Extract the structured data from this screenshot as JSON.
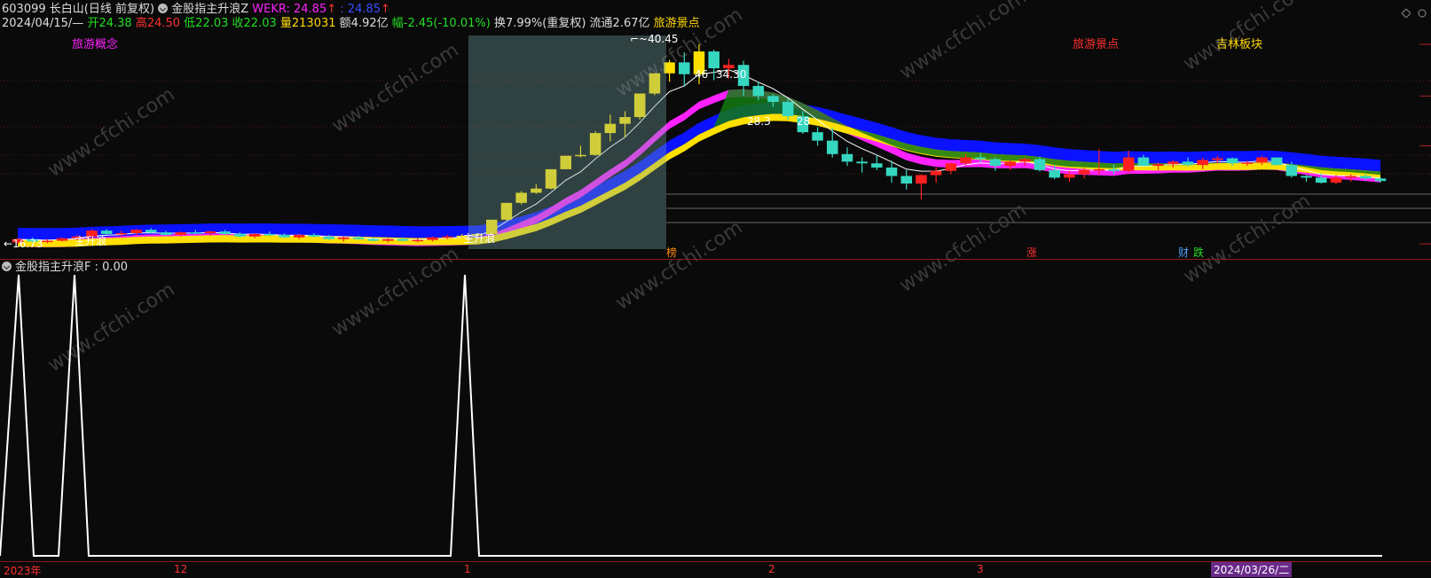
{
  "header": {
    "line1": {
      "code": "603099",
      "name": "长白山",
      "period": "(日线 前复权)",
      "indicator": "金股指主升浪Z",
      "wekr_label": "WEKR: 24.85",
      "wekr_arrow": "↑",
      "wekr2": ": 24.85",
      "wekr2_arrow": "↑"
    },
    "line2": {
      "date": "2024/04/15/—",
      "open": "开24.38",
      "high": "高24.50",
      "low": "低22.03",
      "close": "收22.03",
      "volume": "量213031",
      "amount": "额4.92亿",
      "change": "幅-2.45(-10.01%)",
      "turnover": "换7.99%(重复权)",
      "float": "流通2.67亿",
      "concept": "旅游景点"
    }
  },
  "tags": {
    "tourism_concept": "旅游概念",
    "tourism_spots": "旅游景点",
    "jilin_sector": "吉林板块"
  },
  "annotations": {
    "high_price": "40.45",
    "price_3430": "34.30",
    "price_46": "46",
    "price_2839": "28.3",
    "price_28": "28",
    "low_price": "16.73",
    "zhushenglang1": "主升浪",
    "zhushenglang2": "主升浪",
    "marker_bang": "榜",
    "marker_zhang": "涨",
    "marker_cai": "财",
    "marker_die": "跌"
  },
  "sub_header": {
    "indicator": "金股指主升浪F",
    "value": ": 0.00"
  },
  "xaxis": {
    "labels": [
      "2023年",
      "12",
      "1",
      "2",
      "3"
    ],
    "current_date": "2024/03/26/二"
  },
  "watermark": "www.cfchi.com",
  "colors": {
    "up": "#ff2020",
    "down": "#36d7c0",
    "yellow": "#ffe000",
    "magenta": "#ff22ff",
    "blue": "#0a12ff",
    "green": "#137a13",
    "white": "#ffffff",
    "red_text": "#ff3030",
    "green_text": "#22dd22",
    "gold_text": "#ffd700"
  },
  "chart_data": [
    {
      "type": "candlestick",
      "title": "",
      "x": [
        "2023-11-24",
        "2023-11-27",
        "2023-11-28",
        "2023-11-29",
        "2023-11-30",
        "2023-12-01",
        "2023-12-04",
        "2023-12-05",
        "2023-12-06",
        "2023-12-07",
        "2023-12-08",
        "2023-12-11",
        "2023-12-12",
        "2023-12-13",
        "2023-12-14",
        "2023-12-15",
        "2023-12-18",
        "2023-12-19",
        "2023-12-20",
        "2023-12-21",
        "2023-12-22",
        "2023-12-25",
        "2023-12-26",
        "2023-12-27",
        "2023-12-28",
        "2023-12-29",
        "2024-01-02",
        "2024-01-03",
        "2024-01-04",
        "2024-01-05",
        "2024-01-08",
        "2024-01-09",
        "2024-01-10",
        "2024-01-11",
        "2024-01-12",
        "2024-01-15",
        "2024-01-16",
        "2024-01-17",
        "2024-01-18",
        "2024-01-19",
        "2024-01-22",
        "2024-01-23",
        "2024-01-24",
        "2024-01-25",
        "2024-01-26",
        "2024-01-29",
        "2024-01-30",
        "2024-01-31",
        "2024-02-01",
        "2024-02-02",
        "2024-02-05",
        "2024-02-06",
        "2024-02-07",
        "2024-02-08",
        "2024-02-19",
        "2024-02-20",
        "2024-02-21",
        "2024-02-22",
        "2024-02-23",
        "2024-02-26",
        "2024-02-27",
        "2024-02-28",
        "2024-02-29",
        "2024-03-01",
        "2024-03-04",
        "2024-03-05",
        "2024-03-06",
        "2024-03-07",
        "2024-03-08",
        "2024-03-11",
        "2024-03-12",
        "2024-03-13",
        "2024-03-14",
        "2024-03-15",
        "2024-03-18",
        "2024-03-19",
        "2024-03-20",
        "2024-03-21",
        "2024-03-22",
        "2024-03-25",
        "2024-03-26",
        "2024-03-27",
        "2024-03-28",
        "2024-03-29",
        "2024-04-01",
        "2024-04-02",
        "2024-04-03",
        "2024-04-08",
        "2024-04-09",
        "2024-04-10",
        "2024-04-11",
        "2024-04-12",
        "2024-04-15"
      ],
      "ohlc": [
        [
          16.9,
          17.4,
          16.73,
          17.3
        ],
        [
          17.3,
          17.5,
          16.9,
          17.0
        ],
        [
          17.0,
          17.3,
          16.8,
          17.1
        ],
        [
          17.1,
          17.5,
          17.0,
          17.4
        ],
        [
          17.4,
          17.8,
          17.2,
          17.6
        ],
        [
          17.6,
          18.5,
          17.4,
          18.3
        ],
        [
          18.3,
          18.5,
          17.8,
          17.9
        ],
        [
          17.9,
          18.3,
          17.6,
          18.0
        ],
        [
          18.0,
          18.5,
          17.8,
          18.4
        ],
        [
          18.4,
          18.6,
          18.0,
          18.1
        ],
        [
          18.1,
          18.3,
          17.7,
          17.8
        ],
        [
          17.8,
          18.2,
          17.6,
          18.1
        ],
        [
          18.1,
          18.4,
          17.9,
          18.0
        ],
        [
          18.0,
          18.3,
          17.7,
          18.2
        ],
        [
          18.2,
          18.4,
          17.8,
          17.9
        ],
        [
          17.9,
          18.1,
          17.5,
          17.6
        ],
        [
          17.6,
          18.0,
          17.4,
          17.9
        ],
        [
          17.9,
          18.2,
          17.7,
          17.8
        ],
        [
          17.8,
          18.0,
          17.4,
          17.5
        ],
        [
          17.5,
          17.9,
          17.3,
          17.8
        ],
        [
          17.8,
          18.0,
          17.5,
          17.6
        ],
        [
          17.6,
          17.8,
          17.2,
          17.3
        ],
        [
          17.3,
          17.6,
          17.0,
          17.5
        ],
        [
          17.5,
          17.7,
          17.2,
          17.3
        ],
        [
          17.3,
          17.5,
          17.0,
          17.1
        ],
        [
          17.1,
          17.4,
          16.9,
          17.3
        ],
        [
          17.3,
          17.5,
          17.0,
          17.1
        ],
        [
          17.1,
          17.4,
          16.9,
          17.2
        ],
        [
          17.2,
          17.6,
          17.0,
          17.5
        ],
        [
          17.5,
          17.8,
          17.3,
          17.6
        ],
        [
          17.6,
          17.9,
          17.4,
          17.7
        ],
        [
          17.7,
          18.0,
          17.5,
          17.9
        ],
        [
          17.9,
          19.6,
          17.8,
          19.6
        ],
        [
          19.6,
          21.6,
          19.5,
          21.6
        ],
        [
          21.6,
          23.0,
          21.4,
          22.8
        ],
        [
          22.8,
          23.8,
          22.7,
          23.3
        ],
        [
          23.3,
          25.6,
          23.2,
          25.6
        ],
        [
          25.6,
          27.2,
          25.6,
          27.2
        ],
        [
          27.2,
          28.4,
          27.0,
          27.3
        ],
        [
          27.3,
          30.1,
          27.2,
          29.9
        ],
        [
          29.9,
          32.1,
          28.9,
          31.0
        ],
        [
          31.0,
          32.5,
          29.4,
          31.8
        ],
        [
          31.8,
          34.6,
          31.5,
          34.6
        ],
        [
          34.6,
          37.0,
          34.4,
          37.0
        ],
        [
          37.0,
          38.6,
          36.0,
          38.3
        ],
        [
          38.3,
          39.5,
          35.4,
          36.9
        ],
        [
          36.9,
          40.45,
          35.7,
          39.6
        ],
        [
          39.6,
          39.8,
          36.2,
          37.6
        ],
        [
          37.6,
          38.7,
          36.4,
          38.0
        ],
        [
          38.0,
          38.5,
          34.3,
          35.5
        ],
        [
          35.5,
          36.0,
          33.8,
          34.3
        ],
        [
          34.3,
          34.5,
          33.0,
          33.6
        ],
        [
          33.6,
          34.0,
          31.5,
          31.9
        ],
        [
          31.9,
          32.5,
          29.8,
          30.0
        ],
        [
          30.0,
          30.6,
          28.4,
          29.0
        ],
        [
          29.0,
          30.5,
          27.0,
          27.4
        ],
        [
          27.4,
          28.2,
          26.0,
          26.5
        ],
        [
          26.5,
          27.0,
          25.2,
          26.3
        ],
        [
          26.3,
          27.3,
          25.5,
          25.8
        ],
        [
          25.8,
          26.6,
          24.0,
          24.8
        ],
        [
          24.8,
          25.5,
          23.2,
          23.9
        ],
        [
          23.9,
          25.0,
          22.0,
          24.9
        ],
        [
          24.9,
          25.8,
          24.0,
          25.4
        ],
        [
          25.4,
          26.4,
          25.0,
          26.3
        ],
        [
          26.3,
          27.4,
          26.0,
          27.0
        ],
        [
          27.0,
          27.5,
          26.4,
          26.8
        ],
        [
          26.8,
          27.0,
          25.4,
          26.0
        ],
        [
          26.0,
          26.7,
          25.5,
          26.5
        ],
        [
          26.5,
          27.0,
          26.0,
          26.8
        ],
        [
          26.8,
          27.1,
          25.3,
          25.5
        ],
        [
          25.5,
          26.1,
          24.4,
          24.6
        ],
        [
          24.6,
          25.4,
          24.1,
          25.0
        ],
        [
          25.0,
          25.7,
          24.5,
          25.5
        ],
        [
          25.5,
          28.0,
          25.0,
          25.6
        ],
        [
          25.6,
          26.2,
          25.0,
          25.4
        ],
        [
          25.4,
          27.8,
          25.2,
          27.0
        ],
        [
          27.0,
          27.3,
          26.0,
          26.0
        ],
        [
          26.0,
          26.4,
          25.5,
          26.2
        ],
        [
          26.2,
          26.7,
          25.8,
          26.5
        ],
        [
          26.5,
          27.0,
          25.9,
          26.1
        ],
        [
          26.1,
          27.0,
          25.6,
          26.7
        ],
        [
          26.7,
          27.2,
          26.3,
          26.9
        ],
        [
          26.9,
          27.0,
          26.0,
          26.3
        ],
        [
          26.3,
          26.6,
          26.0,
          26.4
        ],
        [
          26.4,
          27.2,
          26.1,
          27.0
        ],
        [
          27.0,
          27.0,
          26.0,
          26.1
        ],
        [
          26.1,
          26.5,
          24.6,
          24.8
        ],
        [
          24.8,
          24.9,
          24.1,
          24.6
        ],
        [
          24.6,
          25.1,
          23.9,
          24.0
        ],
        [
          24.0,
          24.9,
          23.8,
          24.6
        ],
        [
          24.6,
          25.0,
          24.1,
          24.8
        ],
        [
          24.8,
          25.0,
          24.3,
          24.5
        ],
        [
          24.5,
          24.6,
          24.0,
          24.2
        ]
      ],
      "overlay_bands": [
        "blue",
        "magenta",
        "yellow",
        "green"
      ],
      "horizontal_levels": [
        40.45,
        34.3,
        28.39,
        16.73
      ],
      "marker_labels": [
        "榜",
        "涨",
        "财",
        "跌"
      ]
    },
    {
      "type": "line",
      "title": "金股指主升浪F",
      "series": [
        {
          "name": "金股指主升浪F",
          "x_index": [
            0,
            1,
            2,
            3,
            4,
            5,
            6,
            7,
            8,
            9,
            10,
            11,
            12,
            13,
            14,
            30,
            31,
            32,
            33,
            92
          ],
          "values": [
            0,
            1,
            0,
            0,
            1,
            0,
            0,
            0,
            0,
            0,
            0,
            0,
            0,
            0,
            0,
            0,
            1,
            0,
            0,
            0
          ]
        }
      ],
      "ylim": [
        0,
        1
      ]
    }
  ]
}
